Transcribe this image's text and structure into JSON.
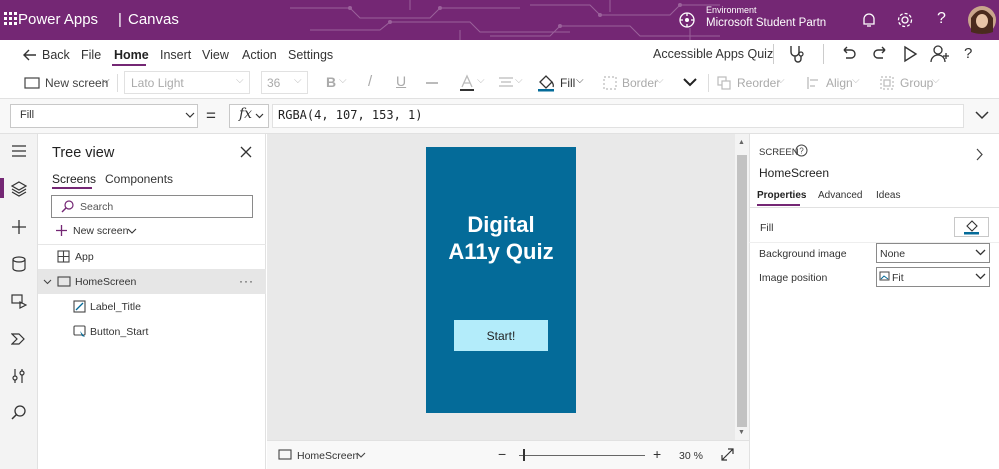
{
  "titlebar": {
    "app_name": "Power Apps",
    "separator": "|",
    "mode": "Canvas",
    "environment_label": "Environment",
    "environment_name": "Microsoft Student Partn"
  },
  "menu": {
    "back": "Back",
    "file": "File",
    "home": "Home",
    "insert": "Insert",
    "view": "View",
    "action": "Action",
    "settings": "Settings",
    "app_title": "Accessible Apps Quiz"
  },
  "ribbon": {
    "new_screen": "New screen",
    "font": "Lato Light",
    "font_size": "36",
    "bold": "B",
    "italic": "/",
    "underline": "U",
    "fill": "Fill",
    "border": "Border",
    "reorder": "Reorder",
    "align": "Align",
    "group": "Group"
  },
  "formula_bar": {
    "property": "Fill",
    "equals": "=",
    "fx": "fx",
    "formula": "RGBA(4, 107, 153, 1)"
  },
  "tree_view": {
    "title": "Tree view",
    "tabs": [
      "Screens",
      "Components"
    ],
    "search_placeholder": "Search",
    "new_screen": "New screen",
    "items": [
      {
        "label": "App"
      },
      {
        "label": "HomeScreen"
      },
      {
        "label": "Label_Title"
      },
      {
        "label": "Button_Start"
      }
    ],
    "more": "···"
  },
  "canvas": {
    "title_text": "Digital A11y Quiz",
    "button_text": "Start!",
    "screen_color": "#046b99",
    "button_color": "#b3ecfa"
  },
  "statusbar": {
    "screen": "HomeScreen",
    "minus": "−",
    "plus": "+",
    "zoom": "30 %",
    "zoom_level": 30
  },
  "right_panel": {
    "type": "SCREEN",
    "name": "HomeScreen",
    "tabs": [
      "Properties",
      "Advanced",
      "Ideas"
    ],
    "fill_label": "Fill",
    "bg_image_label": "Background image",
    "bg_image_value": "None",
    "img_pos_label": "Image position",
    "img_pos_value": "Fit"
  },
  "colors": {
    "brand": "#742774",
    "screen_fill": "#046b99"
  }
}
